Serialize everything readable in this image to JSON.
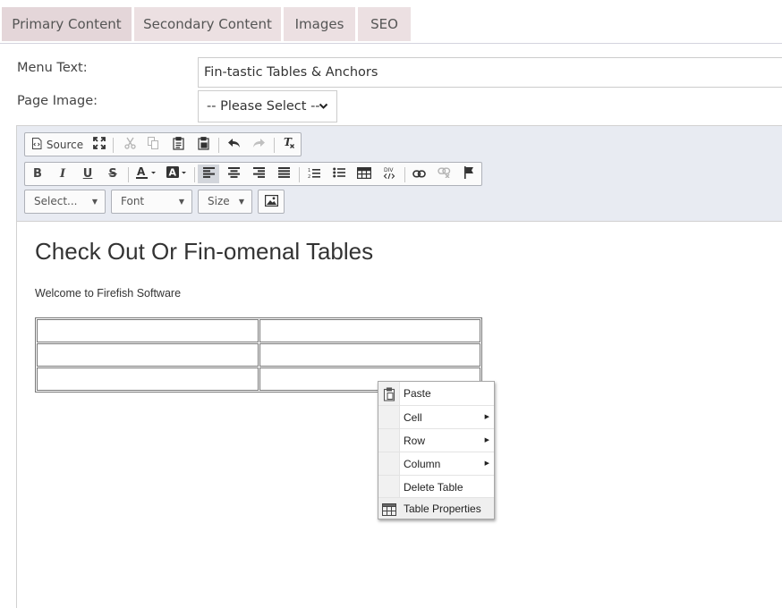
{
  "tabs": [
    {
      "label": "Primary Content",
      "active": true
    },
    {
      "label": "Secondary Content"
    },
    {
      "label": "Images"
    },
    {
      "label": "SEO"
    }
  ],
  "form": {
    "menu_text_label": "Menu Text:",
    "menu_text_value": "Fin-tastic Tables & Anchors",
    "page_image_label": "Page Image:",
    "page_image_value": "-- Please Select --"
  },
  "toolbar": {
    "source_label": "Source",
    "combos": {
      "styles": "Select...",
      "font": "Font",
      "size": "Size"
    },
    "icons": [
      "source-icon",
      "maximize-icon",
      "cut-icon",
      "copy-icon",
      "paste-icon",
      "paste-from-word-icon",
      "undo-icon",
      "redo-icon",
      "remove-format-icon",
      "bold-icon",
      "italic-icon",
      "underline-icon",
      "strikethrough-icon",
      "text-color-icon",
      "background-color-icon",
      "align-left-icon",
      "align-center-icon",
      "align-right-icon",
      "justify-icon",
      "numbered-list-icon",
      "bulleted-list-icon",
      "table-icon",
      "div-container-icon",
      "link-icon",
      "unlink-icon",
      "anchor-icon",
      "image-icon"
    ]
  },
  "content": {
    "heading": "Check Out Or Fin-omenal Tables",
    "paragraph": "Welcome to Firefish Software",
    "table": {
      "rows": 3,
      "cols": 2
    }
  },
  "context_menu": {
    "items": [
      {
        "label": "Paste",
        "icon": "paste-icon"
      },
      {
        "label": "Cell",
        "submenu": true
      },
      {
        "label": "Row",
        "submenu": true
      },
      {
        "label": "Column",
        "submenu": true
      },
      {
        "label": "Delete Table"
      },
      {
        "label": "Table Properties",
        "icon": "table-icon",
        "highlighted": true
      }
    ]
  },
  "colors": {
    "tab_bg": "#ece0e2",
    "toolbar_bg": "#e8ebf2",
    "accent_border": "#aeb1b8"
  }
}
